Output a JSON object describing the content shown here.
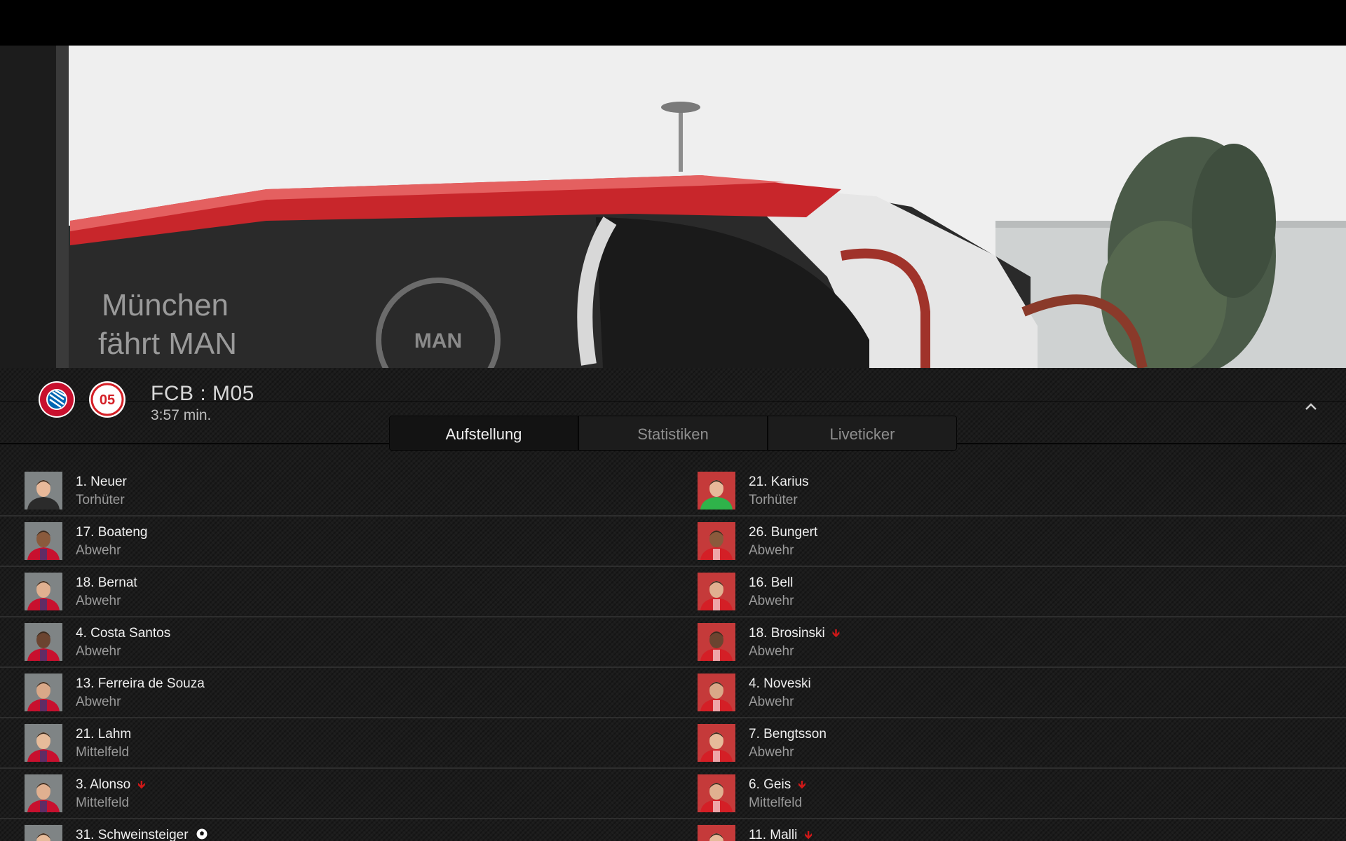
{
  "match": {
    "score": "FCB : M05",
    "time": "3:57 min.",
    "home_logo": "fc-bayern-logo",
    "away_logo": "mainz-05-logo"
  },
  "video": {
    "bus_text_line1": "München",
    "bus_text_line2": "fährt MAN",
    "bus_logo": "MAN"
  },
  "tabs": [
    {
      "label": "Aufstellung",
      "active": true
    },
    {
      "label": "Statistiken",
      "active": false
    },
    {
      "label": "Liveticker",
      "active": false
    }
  ],
  "colors": {
    "panel_bg": "#1b1b1b",
    "substitution_arrow": "#d01818",
    "bayern_red": "#c8102e",
    "mainz_red": "#d41f26"
  },
  "home_players": [
    {
      "name": "1. Neuer",
      "position": "Torhüter",
      "marker": ""
    },
    {
      "name": "17. Boateng",
      "position": "Abwehr",
      "marker": ""
    },
    {
      "name": "18. Bernat",
      "position": "Abwehr",
      "marker": ""
    },
    {
      "name": "4. Costa Santos",
      "position": "Abwehr",
      "marker": ""
    },
    {
      "name": "13. Ferreira de Souza",
      "position": "Abwehr",
      "marker": ""
    },
    {
      "name": "21. Lahm",
      "position": "Mittelfeld",
      "marker": ""
    },
    {
      "name": "3. Alonso",
      "position": "Mittelfeld",
      "marker": "substitution-out-icon"
    },
    {
      "name": "31. Schweinsteiger",
      "position": "",
      "marker": "goal-ball-icon"
    }
  ],
  "away_players": [
    {
      "name": "21. Karius",
      "position": "Torhüter",
      "marker": ""
    },
    {
      "name": "26. Bungert",
      "position": "Abwehr",
      "marker": ""
    },
    {
      "name": "16. Bell",
      "position": "Abwehr",
      "marker": ""
    },
    {
      "name": "18. Brosinski",
      "position": "Abwehr",
      "marker": "substitution-out-icon"
    },
    {
      "name": "4. Noveski",
      "position": "Abwehr",
      "marker": ""
    },
    {
      "name": "7. Bengtsson",
      "position": "Abwehr",
      "marker": ""
    },
    {
      "name": "6. Geis",
      "position": "Mittelfeld",
      "marker": "substitution-out-icon"
    },
    {
      "name": "11. Malli",
      "position": "",
      "marker": "substitution-out-icon"
    }
  ]
}
